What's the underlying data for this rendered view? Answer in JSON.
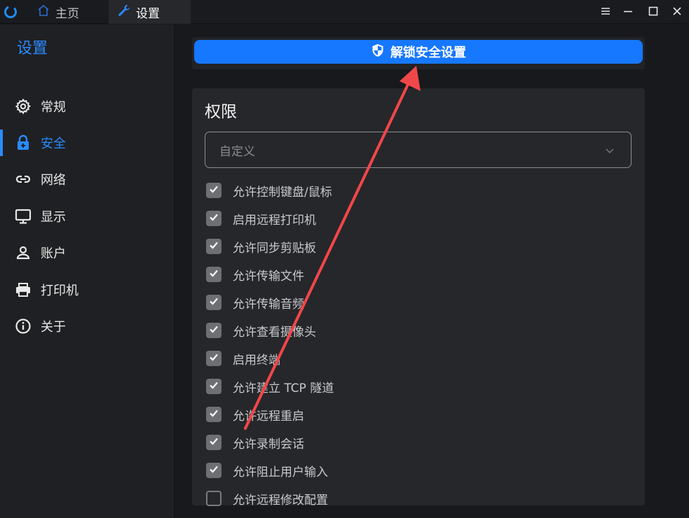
{
  "titlebar": {
    "tabs": [
      {
        "label": "主页",
        "icon": "home-icon"
      },
      {
        "label": "设置",
        "icon": "wrench-icon"
      }
    ],
    "window_controls": [
      "menu-icon",
      "minimize-icon",
      "maximize-icon",
      "close-icon"
    ]
  },
  "sidebar": {
    "title": "设置",
    "items": [
      {
        "label": "常规",
        "icon": "gear-icon"
      },
      {
        "label": "安全",
        "icon": "lock-icon",
        "active": true
      },
      {
        "label": "网络",
        "icon": "link-icon"
      },
      {
        "label": "显示",
        "icon": "monitor-icon"
      },
      {
        "label": "账户",
        "icon": "user-icon"
      },
      {
        "label": "打印机",
        "icon": "printer-icon"
      },
      {
        "label": "关于",
        "icon": "info-icon"
      }
    ]
  },
  "main": {
    "unlock_button_label": "解锁安全设置",
    "permissions": {
      "title": "权限",
      "preset_value": "自定义",
      "items": [
        {
          "label": "允许控制键盘/鼠标",
          "checked": true
        },
        {
          "label": "启用远程打印机",
          "checked": true
        },
        {
          "label": "允许同步剪贴板",
          "checked": true
        },
        {
          "label": "允许传输文件",
          "checked": true
        },
        {
          "label": "允许传输音频",
          "checked": true
        },
        {
          "label": "允许查看摄像头",
          "checked": true
        },
        {
          "label": "启用终端",
          "checked": true
        },
        {
          "label": "允许建立 TCP 隧道",
          "checked": true
        },
        {
          "label": "允许远程重启",
          "checked": true
        },
        {
          "label": "允许录制会话",
          "checked": true
        },
        {
          "label": "允许阻止用户输入",
          "checked": true
        },
        {
          "label": "允许远程修改配置",
          "checked": false
        }
      ]
    }
  },
  "colors": {
    "accent": "#1677ff",
    "arrow": "#f0474a"
  }
}
